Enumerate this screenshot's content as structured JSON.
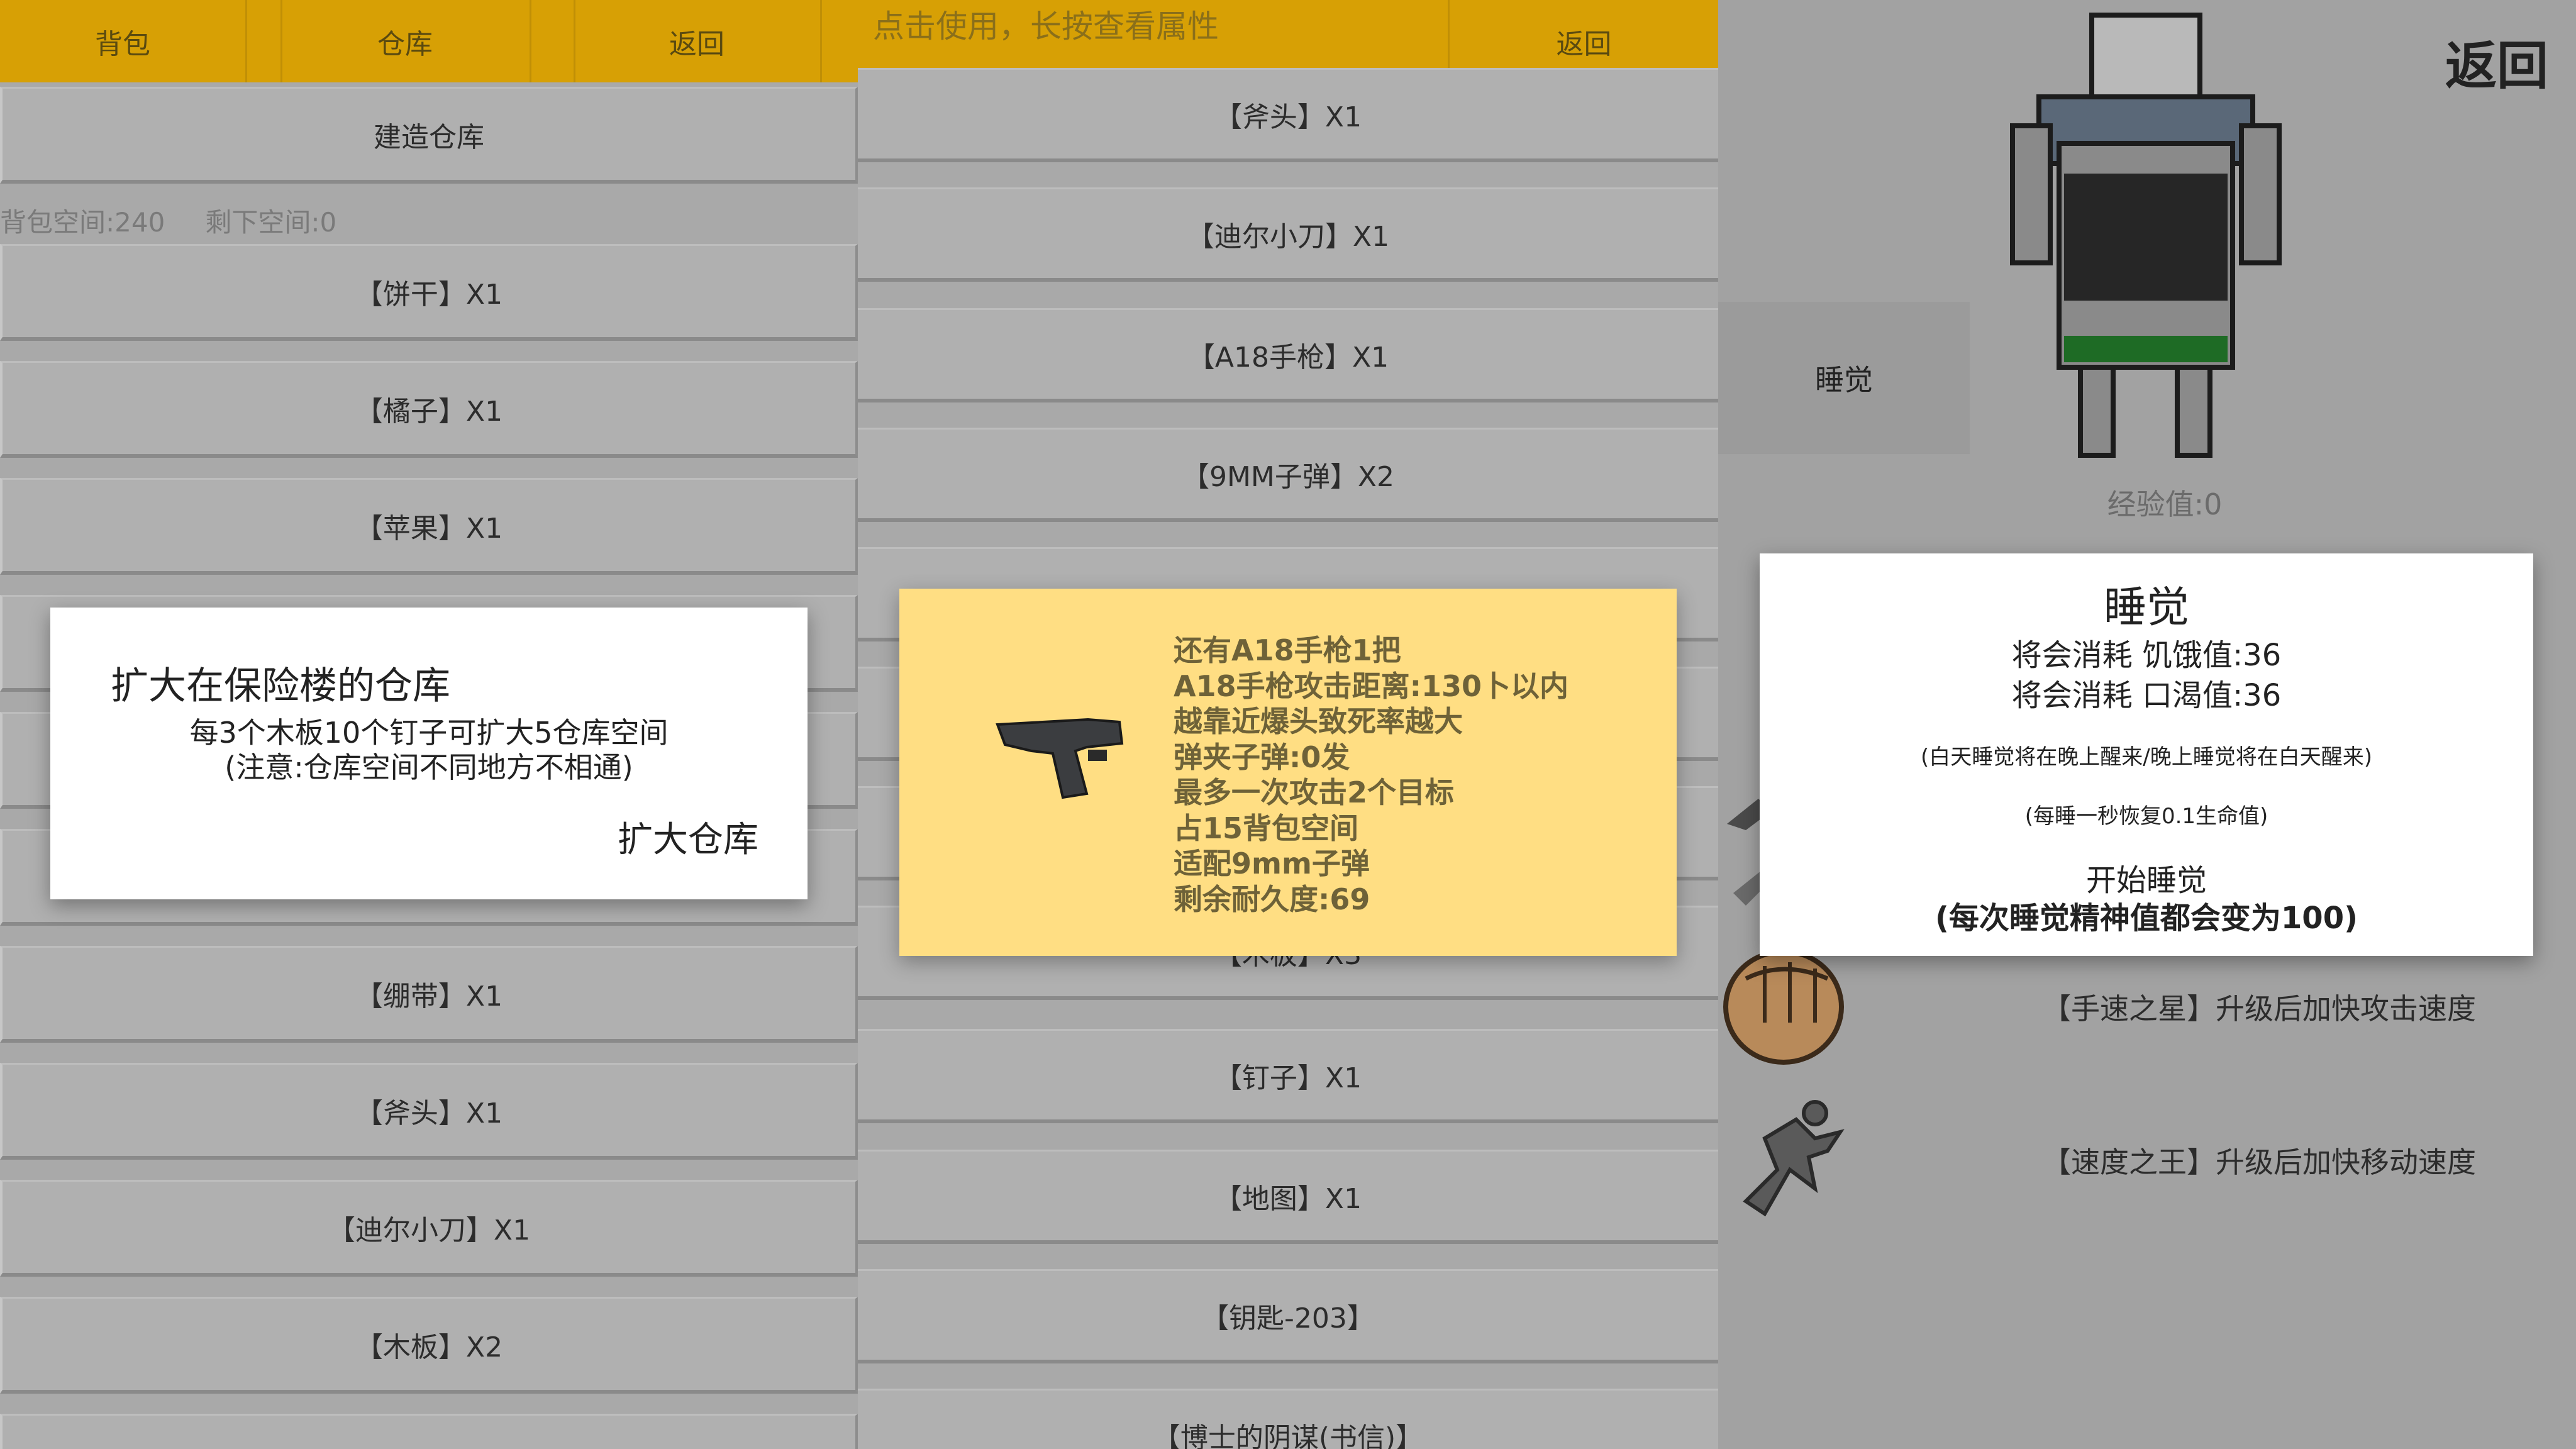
{
  "panel1": {
    "tabs": [
      "背包",
      "仓库",
      "返回"
    ],
    "build_button": "建造仓库",
    "backpack_space": "背包空间:240",
    "remaining_space": "剩下空间:0",
    "items": [
      "【饼干】X1",
      "【橘子】X1",
      "【苹果】X1",
      "【绷带】X1",
      "【斧头】X1",
      "【迪尔小刀】X1",
      "【木板】X2"
    ]
  },
  "warehouse_dialog": {
    "title": "扩大在保险楼的仓库",
    "line1": "每3个木板10个钉子可扩大5仓库空间",
    "line2": "(注意:仓库空间不同地方不相通)",
    "action": "扩大仓库"
  },
  "panel2": {
    "hint": "点击使用，长按查看属性",
    "back": "返回",
    "items": [
      "【斧头】X1",
      "【迪尔小刀】X1",
      "【A18手枪】X1",
      "【9MM子弹】X2",
      "【木板】X3",
      "【钉子】X1",
      "【地图】X1",
      "【钥匙-203】",
      "【博士的阴谋(书信)】"
    ]
  },
  "item_dialog": {
    "icon": "pistol-icon",
    "lines": [
      "还有A18手枪1把",
      "A18手枪攻击距离:130卜以内",
      "越靠近爆头致死率越大",
      "弹夹子弹:0发",
      "最多一次攻击2个目标",
      "占15背包空间",
      "适配9mm子弹",
      "剩余耐久度:69"
    ]
  },
  "panel3": {
    "back": "返回",
    "sleep_label": "睡觉",
    "exp": "经验值:0",
    "skills": [
      {
        "icon": "fist-icon",
        "label": "【手速之星】升级后加快攻击速度"
      },
      {
        "icon": "runner-icon",
        "label": "【速度之王】升级后加快移动速度"
      }
    ],
    "colors": {
      "shirt": "#5a6878",
      "pants_band": "#1e6b25",
      "skin": "#8a8a8a"
    }
  },
  "sleep_dialog": {
    "title": "睡觉",
    "hunger": "将会消耗 饥饿值:36",
    "thirst": "将会消耗 口渴值:36",
    "note1": "(白天睡觉将在晚上醒来/晚上睡觉将在白天醒来)",
    "note2": "(每睡一秒恢复0.1生命值)",
    "start": "开始睡觉",
    "start_note": "(每次睡觉精神值都会变为100)"
  },
  "colors": {
    "header": "#d7a005",
    "item_dialog_bg": "#ffde83"
  }
}
